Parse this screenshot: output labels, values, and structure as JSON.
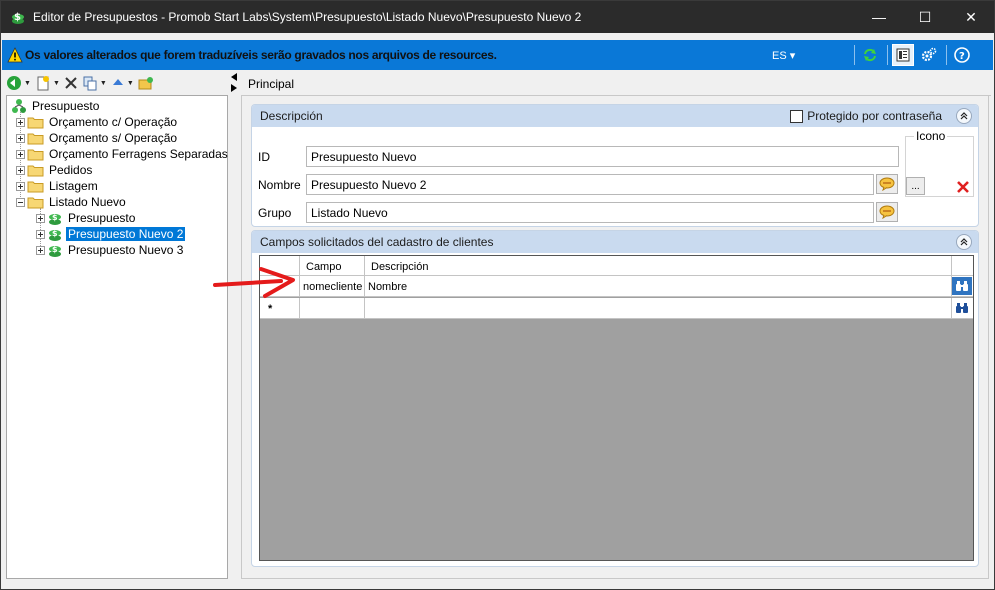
{
  "window": {
    "title": "Editor de Presupuestos - Promob Start Labs\\System\\Presupuesto\\Listado Nuevo\\Presupuesto Nuevo 2",
    "minimize": "—",
    "maximize": "☐",
    "close": "✕"
  },
  "infobar": {
    "message": "Os valores alterados que forem traduzíveis serão gravados nos arquivos de resources.",
    "language": "ES ▾",
    "background": "#0a78d7"
  },
  "tree": {
    "root": "Presupuesto",
    "items": [
      {
        "label": "Orçamento c/ Operação"
      },
      {
        "label": "Orçamento s/ Operação"
      },
      {
        "label": "Orçamento Ferragens Separadas"
      },
      {
        "label": "Pedidos"
      },
      {
        "label": "Listagem"
      },
      {
        "label": "Listado Nuevo"
      },
      {
        "label": "Presupuesto"
      },
      {
        "label": "Presupuesto Nuevo 2"
      },
      {
        "label": "Presupuesto Nuevo 3"
      }
    ],
    "selected": "Presupuesto Nuevo 2"
  },
  "tab": {
    "label": "Principal"
  },
  "descripcion": {
    "header": "Descripción",
    "protegido_label": "Protegido por contraseña",
    "icono_label": "Icono",
    "id_label": "ID",
    "id_value": "Presupuesto Nuevo",
    "nombre_label": "Nombre",
    "nombre_value": "Presupuesto Nuevo 2",
    "grupo_label": "Grupo",
    "grupo_value": "Listado Nuevo",
    "browse_label": "..."
  },
  "campos": {
    "header": "Campos solicitados del cadastro de clientes",
    "columns": [
      "Campo",
      "Descripción"
    ],
    "rows": [
      {
        "campo": "nomecliente",
        "descripcion": "Nombre"
      }
    ],
    "new_row_marker": "*"
  }
}
